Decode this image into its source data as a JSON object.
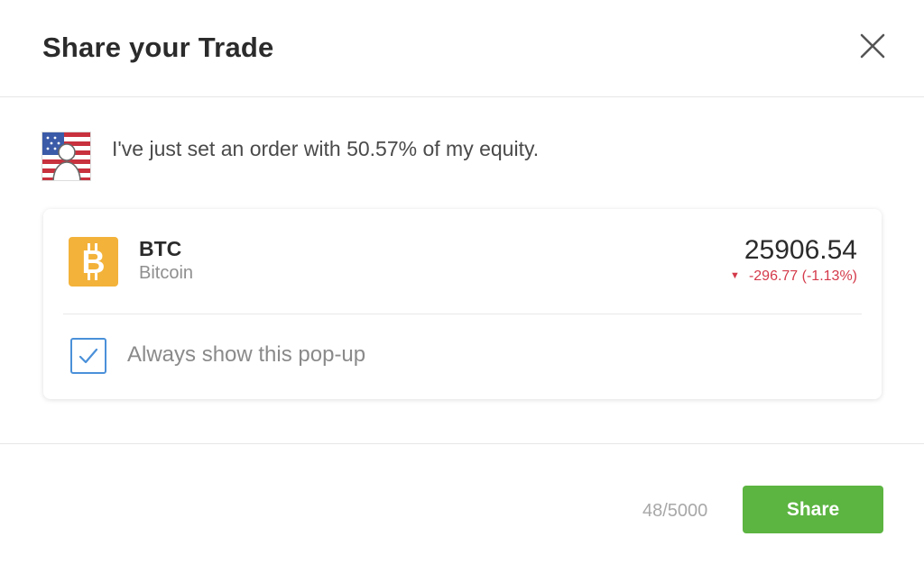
{
  "dialog": {
    "title": "Share your Trade",
    "close_icon": "close-icon"
  },
  "post": {
    "avatar_icon": "user-avatar-flag",
    "message": "I've just set an order with 50.57% of my equity."
  },
  "instrument": {
    "icon": "bitcoin-icon",
    "ticker": "BTC",
    "name": "Bitcoin",
    "price": "25906.54",
    "change_arrow": "▼",
    "change": "-296.77 (-1.13%)",
    "change_color": "#d43a4b",
    "icon_color": "#f3b23a"
  },
  "option": {
    "label": "Always show this pop-up",
    "checked": true,
    "checkbox_color": "#4a90d9"
  },
  "footer": {
    "char_count": "48/5000",
    "share_label": "Share",
    "share_color": "#5cb441"
  }
}
